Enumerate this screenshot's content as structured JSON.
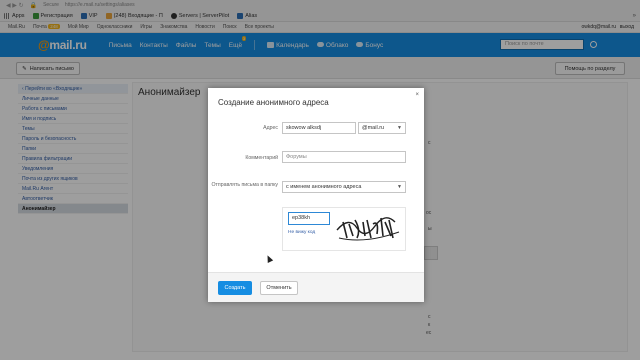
{
  "browser": {
    "address": "https://e.mail.ru/settings/aliases",
    "security_label": "Secure",
    "bookmarks": [
      "Apps",
      "Регистрация",
      "VIP",
      "(248) Входящие - П",
      "Servers | ServerPilot",
      "Alias"
    ],
    "more_label": "»"
  },
  "portal": {
    "items": [
      "Mail.Ru",
      "Почта",
      "Мой Мир",
      "Одноклассники",
      "Игры",
      "Знакомства",
      "Новости",
      "Поиск",
      "Все проекты"
    ],
    "mail_badge": "248",
    "user": "owkdq@mail.ru",
    "exit_label": "выход"
  },
  "mailhead": {
    "logo_at": "@",
    "logo_text": "mail.ru",
    "nav": [
      "Письма",
      "Контакты",
      "Файлы",
      "Темы",
      "Ещё"
    ],
    "more_badge": "3",
    "services": [
      "Календарь",
      "Облако",
      "Бонус"
    ],
    "search_placeholder": "Поиск по почте"
  },
  "toolbar": {
    "write_label": "Написать письмо",
    "help_label": "Помощь по разделу"
  },
  "sidebar": {
    "items": [
      "Перейти во «Входящие»",
      "Личные данные",
      "Работа с письмами",
      "Имя и подпись",
      "Темы",
      "Пароль и безопасность",
      "Папки",
      "Правила фильтрации",
      "Уведомления",
      "Почта из других ящиков",
      "Mail.Ru Агент",
      "Автоответчик",
      "Анонимайзер"
    ]
  },
  "content": {
    "title": "Анонимайзер",
    "fragment_1": "с",
    "fragment_2": "ос",
    "fragment_3": "ы",
    "fragment_4": "с",
    "fragment_5": "к",
    "fragment_6": "ес"
  },
  "modal": {
    "title": "Создание анонимного адреса",
    "close": "×",
    "address_label": "Адрес",
    "address_value": "skowow alksdj",
    "domain_value": "@mail.ru",
    "comment_label": "Комментарий",
    "comment_placeholder": "Форумы",
    "folder_label": "Отправлять письма в папку",
    "folder_value": "с именем анонимного адреса",
    "captcha_value": "ep38kh",
    "captcha_link": "Не вижу код",
    "create_label": "Создать",
    "cancel_label": "Отменить"
  }
}
